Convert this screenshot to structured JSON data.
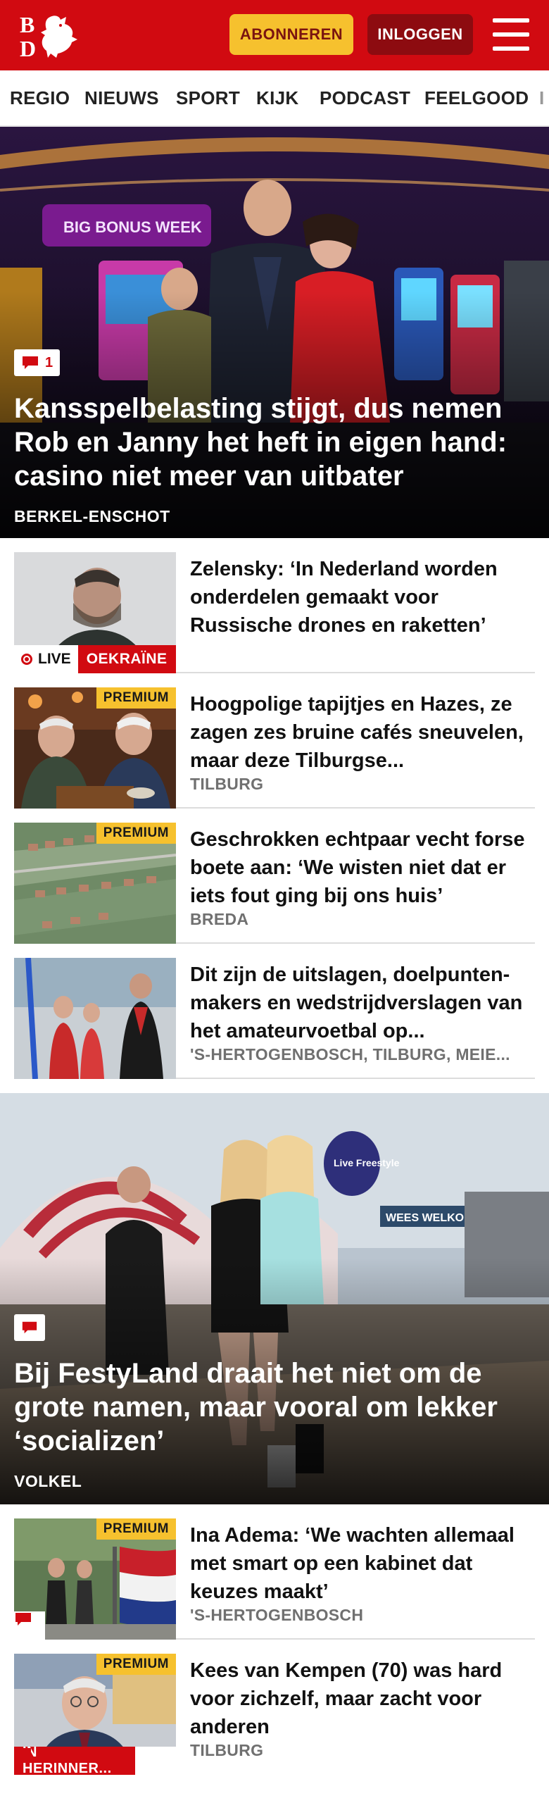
{
  "header": {
    "logo_icon": "bd-lion-logo",
    "logo_text": "BD",
    "subscribe_label": "ABONNEREN",
    "login_label": "INLOGGEN",
    "menu_icon": "hamburger-menu-icon",
    "brand_color": "#d10a11",
    "accent_color": "#f6c12e"
  },
  "nav": {
    "items": [
      "REGIO",
      "NIEUWS",
      "SPORT",
      "KIJK",
      "PODCAST",
      "FEELGOOD",
      "I"
    ]
  },
  "hero1": {
    "comment_count": "1",
    "title": "Kansspelbelasting stijgt, dus nemen Rob en Janny het heft in eigen hand: casino niet meer van uitbater",
    "location": "BERKEL-ENSCHOT",
    "sign_text": "BIG BONUS WEEK"
  },
  "articles": [
    {
      "title": "Zelensky: ‘In Nederland worden onderdelen gemaakt voor Russische drones en raketten’",
      "live_label": "LIVE",
      "tag": "OEKRAÏNE"
    },
    {
      "title": "Hoogpolige tapijtjes en Hazes, ze zagen zes bruine cafés sneuvelen, maar deze Tilburgse...",
      "location": "TILBURG",
      "premium": "PREMIUM"
    },
    {
      "title": "Geschrokken echtpaar vecht forse boete aan: ‘We wisten niet dat er iets fout ging bij ons huis’",
      "location": "BREDA",
      "premium": "PREMIUM"
    },
    {
      "title": "Dit zijn de uitslagen, doelpunten­makers en wedstrijdverslagen van het amateurvoetbal op...",
      "location": "'S-HERTOGENBOSCH, TILBURG, MEIE..."
    }
  ],
  "hero2": {
    "title": "Bij FestyLand draait het niet om de grote namen, maar vooral om lekker ‘socializen’",
    "location": "VOLKEL",
    "sign_text_1": "WEES WELKOM",
    "sign_text_2": "Live Freestyle"
  },
  "articles2": [
    {
      "title": "Ina Adema: ‘We wachten allemaal met smart op een kabinet dat keuzes maakt’",
      "location": "'S-HERTOGENBOSCH",
      "premium": "PREMIUM"
    },
    {
      "title": "Kees van Kempen (70) was hard voor zichzelf, maar zacht voor anderen",
      "location": "TILBURG",
      "premium": "PREMIUM",
      "tag": "IN HERINNER..."
    }
  ]
}
